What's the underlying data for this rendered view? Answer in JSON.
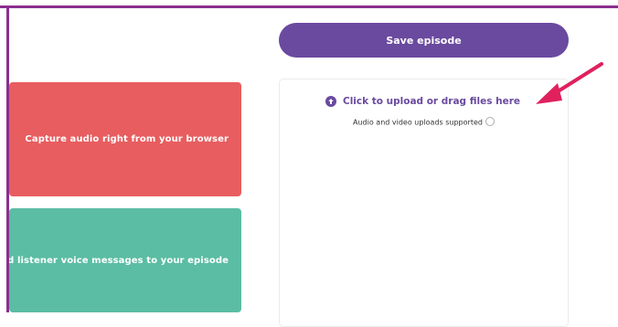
{
  "actions": {
    "save_label": "Save episode"
  },
  "cards": {
    "record_text": "Capture audio right from your browser",
    "voice_text": "dd listener voice messages to your episode"
  },
  "upload": {
    "cta_label": "Click to upload or drag files here",
    "supported_text": "Audio and video uploads supported"
  },
  "icons": {
    "upload": "upload-circle-icon",
    "info": "info-icon",
    "arrow": "arrow-annotation"
  },
  "colors": {
    "frame": "#8a2f8f",
    "primary": "#6a4a9f",
    "record_card": "#e85d5f",
    "voice_card": "#5bbda3",
    "annotation_arrow": "#e0215e"
  }
}
